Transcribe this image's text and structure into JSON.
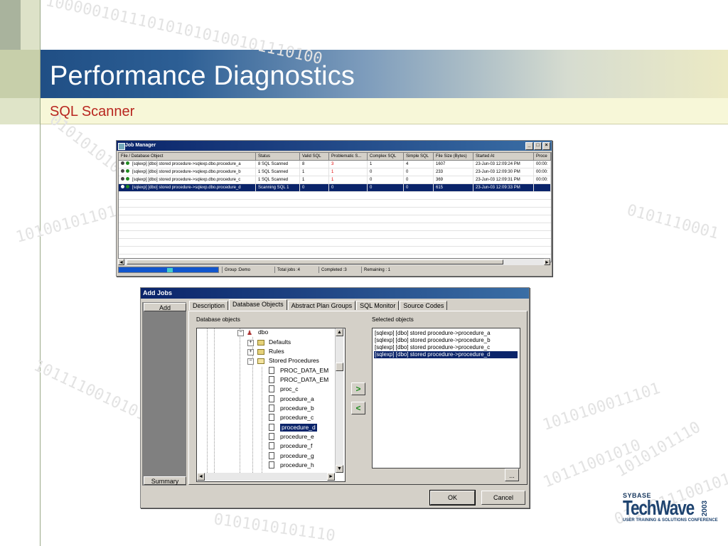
{
  "slide": {
    "title": "Performance Diagnostics",
    "subtitle": "SQL Scanner",
    "background_digits": [
      "100000101110101010100101110100",
      "010101010",
      "1010010110101",
      "10111100101010",
      "0101110001",
      "1010100011101",
      "10111001010",
      "0101010101110",
      "1010101110",
      "0111011100101"
    ]
  },
  "job_manager": {
    "title": "Job Manager",
    "window_buttons": [
      "_",
      "□",
      "×"
    ],
    "columns": [
      "File / Database Object",
      "Status",
      "Valid SQL",
      "Problematic S...",
      "Complex SQL",
      "Simple SQL",
      "File Size (Bytes)",
      "Started At",
      "Proce"
    ],
    "rows": [
      {
        "object": "[sqlexp] [dbo] stored procedure->sqlexp.dbo.procedure_a",
        "status": "8 SQL Scanned",
        "valid": "8",
        "problematic": "3",
        "complex": "1",
        "simple": "4",
        "size": "1607",
        "started": "23-Jun-03 12:09:24 PM",
        "proc": "00:00:"
      },
      {
        "object": "[sqlexp] [dbo] stored procedure->sqlexp.dbo.procedure_b",
        "status": "1 SQL Scanned",
        "valid": "1",
        "problematic": "1",
        "complex": "0",
        "simple": "0",
        "size": "233",
        "started": "23-Jun-03 12:09:30 PM",
        "proc": "00:00:"
      },
      {
        "object": "[sqlexp] [dbo] stored procedure->sqlexp.dbo.procedure_c",
        "status": "1 SQL Scanned",
        "valid": "1",
        "problematic": "1",
        "complex": "0",
        "simple": "0",
        "size": "369",
        "started": "23-Jun-03 12:09:31 PM",
        "proc": "00:00:"
      },
      {
        "object": "[sqlexp] [dbo] stored procedure->sqlexp.dbo.procedure_d",
        "status": "Scanning SQL 1",
        "valid": "0",
        "problematic": "0",
        "complex": "0",
        "simple": "0",
        "size": "615",
        "started": "23-Jun-03 12:09:33 PM",
        "proc": ""
      }
    ],
    "status": {
      "group": "Group :Demo",
      "total": "Total jobs :4",
      "completed": "Completed :3",
      "remaining": "Remaining : 1"
    }
  },
  "add_jobs": {
    "title": "Add Jobs",
    "left_buttons": {
      "add": "Add",
      "summary": "Summary"
    },
    "tabs": [
      "Description",
      "Database Objects",
      "Abstract Plan Groups",
      "SQL Monitor",
      "Source Codes"
    ],
    "active_tab": "Database Objects",
    "database_objects_label": "Database objects",
    "selected_objects_label": "Selected objects",
    "tree": [
      {
        "label": "dbo",
        "kind": "user"
      },
      {
        "label": "Defaults",
        "kind": "folder"
      },
      {
        "label": "Rules",
        "kind": "folder"
      },
      {
        "label": "Stored Procedures",
        "kind": "open-folder"
      },
      {
        "label": "PROC_DATA_EM",
        "kind": "proc"
      },
      {
        "label": "PROC_DATA_EM",
        "kind": "proc"
      },
      {
        "label": "proc_c",
        "kind": "proc"
      },
      {
        "label": "procedure_a",
        "kind": "proc"
      },
      {
        "label": "procedure_b",
        "kind": "proc"
      },
      {
        "label": "procedure_c",
        "kind": "proc"
      },
      {
        "label": "procedure_d",
        "kind": "proc",
        "selected": true
      },
      {
        "label": "procedure_e",
        "kind": "proc"
      },
      {
        "label": "procedure_f",
        "kind": "proc"
      },
      {
        "label": "procedure_g",
        "kind": "proc"
      },
      {
        "label": "procedure_h",
        "kind": "proc"
      }
    ],
    "selected": [
      "[sqlexp] [dbo] stored procedure->procedure_a",
      "[sqlexp] [dbo] stored procedure->procedure_b",
      "[sqlexp] [dbo] stored procedure->procedure_c",
      "[sqlexp] [dbo] stored procedure->procedure_d"
    ],
    "move_right": ">",
    "move_left": "<",
    "browse": "...",
    "ok": "OK",
    "cancel": "Cancel"
  },
  "logo": {
    "brand": "SYBASE",
    "name": "TechWave",
    "year": "2003",
    "tagline": "USER TRAINING & SOLUTIONS CONFERENCE"
  }
}
